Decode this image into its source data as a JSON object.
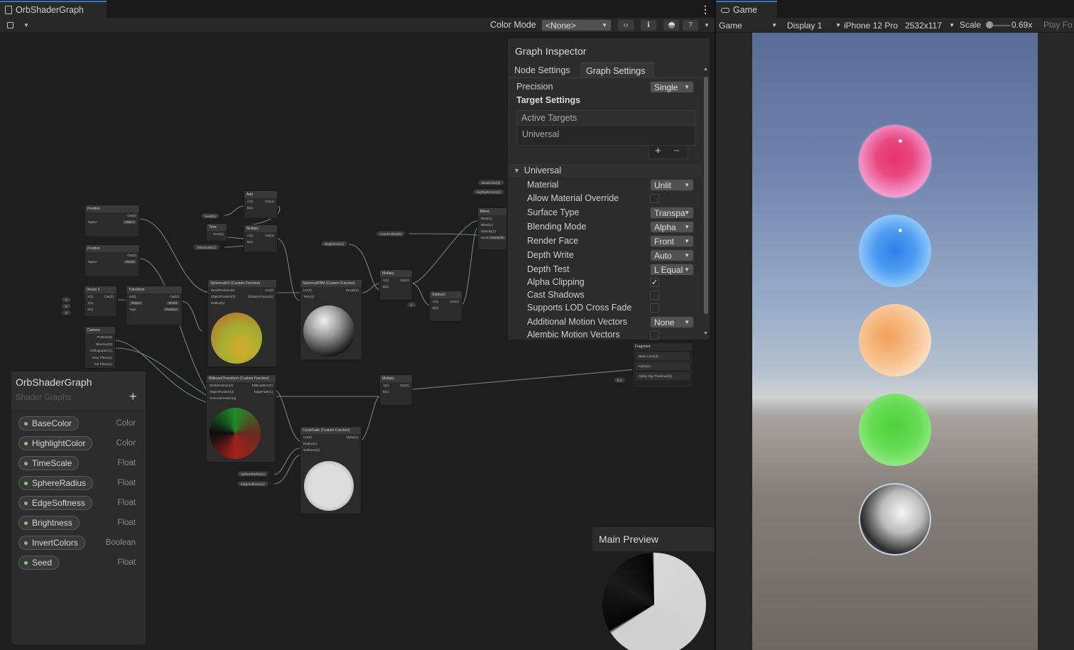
{
  "shader_window": {
    "tab_title": "OrbShaderGraph",
    "toolbar": {
      "color_mode_label": "Color Mode",
      "color_mode_value": "<None>"
    },
    "nodes": {
      "position1": {
        "title": "Position",
        "out": "Out(3)",
        "space_label": "Space",
        "space_value": "Object"
      },
      "position2": {
        "title": "Position",
        "out": "Out(3)",
        "space_label": "Space",
        "space_value": "World"
      },
      "vector3": {
        "title": "Vector 3",
        "x": "X(1)",
        "y": "Y(1)",
        "z": "Z(1)",
        "out": "Out(3)",
        "xv": "0",
        "yv": "0",
        "zv": "0"
      },
      "transform": {
        "title": "Transform",
        "in": "In(3)",
        "out": "Out(3)",
        "from": "Object",
        "to": "World",
        "type_label": "Type",
        "type_value": "Position"
      },
      "camera": {
        "title": "Camera",
        "rows": [
          "Position(3)",
          "Direction(3)",
          "Orthographic(1)",
          "Near Plane(1)",
          "Far Plane(1)"
        ]
      },
      "add": {
        "title": "Add",
        "a": "A(1)",
        "b": "B(1)",
        "out": "Out(1)"
      },
      "time": {
        "title": "Time",
        "out": "Time(1)"
      },
      "multiply1": {
        "title": "Multiply",
        "a": "A(1)",
        "b": "B(1)",
        "out": "Out(1)"
      },
      "sphericaluv": {
        "title": "SphericalUV (Custom Function)",
        "in1": "WorldPosition(3)",
        "in2": "ObjectPosition(3)",
        "in3": "Radius(1)",
        "out1": "UV(2)",
        "out2": "DistanceFactor(1)"
      },
      "sphericalfbm": {
        "title": "SphericalFBM (Custom Function)",
        "in1": "UV(2)",
        "in2": "Time(1)",
        "out": "Result(1)"
      },
      "multiply2": {
        "title": "Multiply",
        "a": "A(1)",
        "b": "B(1)",
        "out": "Out(1)"
      },
      "subtract": {
        "title": "Subtract",
        "a": "A(1)",
        "b": "B(1)",
        "out": "Out(1)",
        "av": "1"
      },
      "blend": {
        "title": "Blend",
        "base": "Base(1)",
        "blend": "Blend(1)",
        "opacity": "Opacity(1)",
        "mode_label": "Mode",
        "mode_value": "Overwrite"
      },
      "billboard": {
        "title": "BillboardTransform (Custom Function)",
        "in1": "WorldPosition(3)",
        "in2": "ObjectPosition(3)",
        "in3": "CameraPosition(3)",
        "out1": "BillboardUV(2)",
        "out2": "EdgeFade(1)"
      },
      "multiply3": {
        "title": "Multiply",
        "a": "A(1)",
        "b": "B(1)",
        "out": "Out(1)"
      },
      "circlefade": {
        "title": "CircleFade (Custom Function)",
        "in1": "UV(2)",
        "in2": "Radius(1)",
        "in3": "Softness(1)",
        "out": "Alpha(1)"
      },
      "fragment": {
        "title": "Fragment",
        "rows": [
          "Base Color(3)",
          "Alpha(1)",
          "Alpha Clip Threshold(1)"
        ],
        "x_value": "0.1"
      }
    },
    "property_pills": {
      "seed": "Seed(1)",
      "timescale": "TimeScale(1)",
      "brightness": "Brightness(1)",
      "invertcolors": "InvertColors(B)",
      "basecolor": "BaseColor(4)",
      "highlightcolor": "HighlightColor(4)",
      "sphereradius": "SphereRadius(1)",
      "edgesoftness": "EdgeSoftness(1)"
    },
    "blackboard": {
      "title": "OrbShaderGraph",
      "subtitle": "Shader Graphs",
      "add_symbol": "+",
      "properties": [
        {
          "name": "BaseColor",
          "type": "Color"
        },
        {
          "name": "HighlightColor",
          "type": "Color"
        },
        {
          "name": "TimeScale",
          "type": "Float"
        },
        {
          "name": "SphereRadius",
          "type": "Float"
        },
        {
          "name": "EdgeSoftness",
          "type": "Float"
        },
        {
          "name": "Brightness",
          "type": "Float"
        },
        {
          "name": "InvertColors",
          "type": "Boolean"
        },
        {
          "name": "Seed",
          "type": "Float"
        }
      ]
    },
    "inspector": {
      "title": "Graph Inspector",
      "tabs": [
        "Node Settings",
        "Graph Settings"
      ],
      "active_tab": "Graph Settings",
      "precision_label": "Precision",
      "precision_value": "Single",
      "target_settings_label": "Target Settings",
      "active_targets_label": "Active Targets",
      "active_targets": [
        "Universal"
      ],
      "add_symbol": "+",
      "remove_symbol": "−",
      "section_title": "Universal",
      "settings": [
        {
          "label": "Material",
          "kind": "dropdown",
          "value": "Unlit"
        },
        {
          "label": "Allow Material Override",
          "kind": "checkbox",
          "checked": false
        },
        {
          "label": "Surface Type",
          "kind": "dropdown",
          "value": "Transpa"
        },
        {
          "label": "Blending Mode",
          "kind": "dropdown",
          "value": "Alpha"
        },
        {
          "label": "Render Face",
          "kind": "dropdown",
          "value": "Front"
        },
        {
          "label": "Depth Write",
          "kind": "dropdown",
          "value": "Auto"
        },
        {
          "label": "Depth Test",
          "kind": "dropdown",
          "value": "L Equal"
        },
        {
          "label": "Alpha Clipping",
          "kind": "checkbox",
          "checked": true
        },
        {
          "label": "Cast Shadows",
          "kind": "checkbox",
          "checked": false
        },
        {
          "label": "Supports LOD Cross Fade",
          "kind": "checkbox",
          "checked": false
        },
        {
          "label": "Additional Motion Vectors",
          "kind": "dropdown",
          "value": "None"
        },
        {
          "label": "Alembic Motion Vectors",
          "kind": "checkbox",
          "checked": false
        }
      ]
    },
    "main_preview": {
      "title": "Main Preview"
    }
  },
  "game_window": {
    "tab_title": "Game",
    "toolbar": {
      "view_value": "Game",
      "display_value": "Display 1",
      "device_value": "iPhone 12 Pro",
      "resolution_value": "2532x117",
      "scale_label": "Scale",
      "scale_value": "0.69x",
      "play_label": "Play Fo"
    },
    "orbs": [
      {
        "color": "#e8457c"
      },
      {
        "color": "#4a9af0"
      },
      {
        "color": "#f3a86a"
      },
      {
        "color": "#5ad64a"
      },
      {
        "color": "#d8d8d8"
      }
    ]
  },
  "colors": {
    "accent_tab": "#3a79bb",
    "property_dot": "#8fbf7a",
    "wire_color": "#7fa8a8"
  }
}
